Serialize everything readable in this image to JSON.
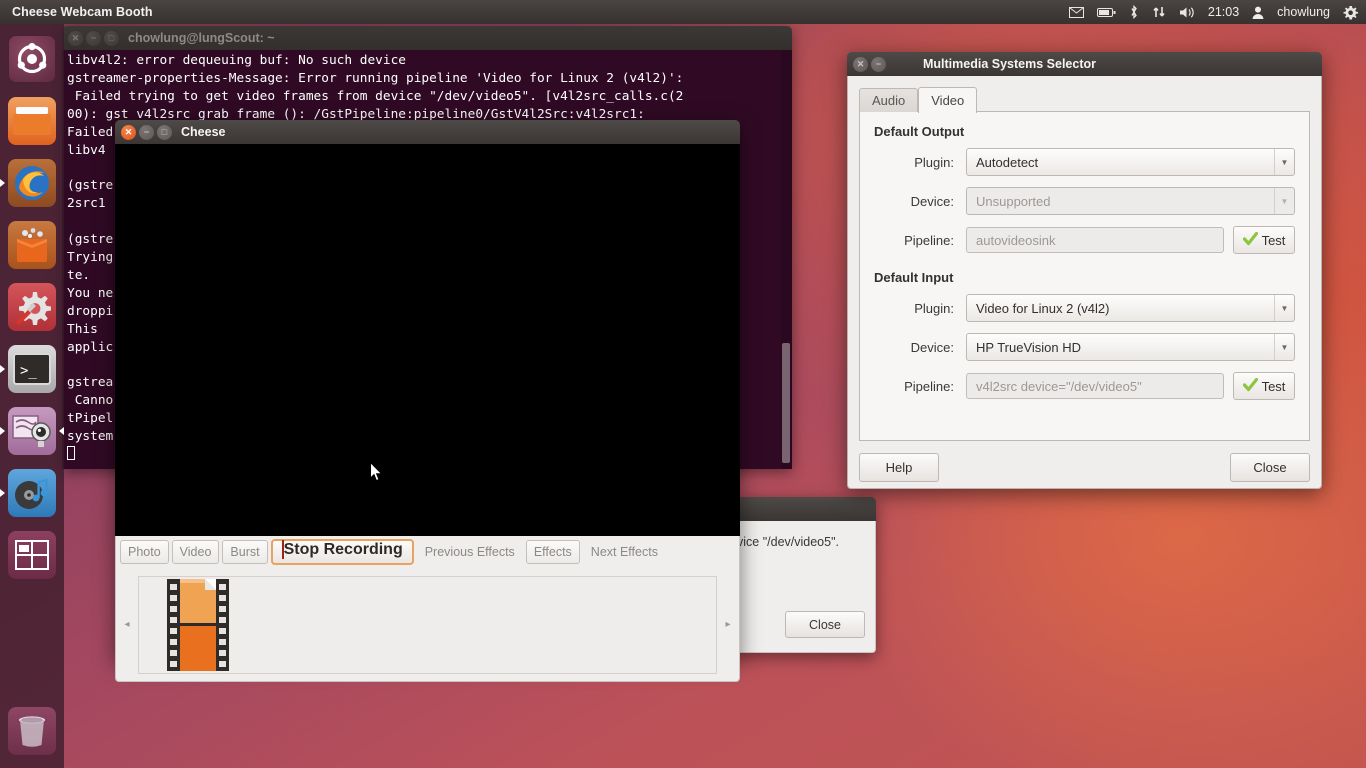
{
  "panel": {
    "title": "Cheese Webcam Booth",
    "clock": "21:03",
    "user": "chowlung",
    "icons": [
      "mail-icon",
      "battery-icon",
      "bluetooth-icon",
      "network-icon",
      "volume-icon",
      "session-gear-icon"
    ]
  },
  "launcher": {
    "items": [
      {
        "name": "ubuntu-dash",
        "label": "Dash home"
      },
      {
        "name": "files",
        "label": "Files"
      },
      {
        "name": "firefox",
        "label": "Firefox Web Browser"
      },
      {
        "name": "software-center",
        "label": "Ubuntu Software Center"
      },
      {
        "name": "system-settings",
        "label": "System Settings"
      },
      {
        "name": "terminal",
        "label": "Terminal"
      },
      {
        "name": "cheese",
        "label": "Cheese"
      },
      {
        "name": "rhythmbox",
        "label": "Rhythmbox"
      },
      {
        "name": "workspace-switcher",
        "label": "Workspace Switcher"
      },
      {
        "name": "trash",
        "label": "Trash"
      }
    ]
  },
  "terminal": {
    "title": "chowlung@lungScout: ~",
    "lines": [
      "libv4l2: error dequeuing buf: No such device",
      "gstreamer-properties-Message: Error running pipeline 'Video for Linux 2 (v4l2)':",
      " Failed trying to get video frames from device \"/dev/video5\". [v4l2src_calls.c(2",
      "00): gst_v4l2src_grab_frame (): /GstPipeline:pipeline0/GstV4l2Src:v4l2src1:",
      "Failed",
      "libv4",
      "",
      "(gstre                                                                 d v4l",
      "2src1",
      "",
      "(gstre",
      "Trying                                                                 L sta",
      "te.",
      "You ne",
      "droppi",
      "This ",
      "applic",
      "",
      "gstrea                                                              l2)':",
      " Canno                                                              : /Gs",
      "tPipel",
      "system"
    ]
  },
  "cheese": {
    "title": "Cheese",
    "buttons": {
      "photo": "Photo",
      "video": "Video",
      "burst": "Burst",
      "stop_recording": "Stop Recording",
      "previous_effects": "Previous Effects",
      "effects": "Effects",
      "next_effects": "Next Effects"
    },
    "thumbnail": {
      "name": "video-file-thumbnail"
    },
    "nav": {
      "prev": "◂",
      "next": "▸"
    }
  },
  "error_dialog": {
    "text": "vice \"/dev/video5\".",
    "close_label": "Close"
  },
  "mss": {
    "title": "Multimedia Systems Selector",
    "tabs": [
      {
        "label": "Audio",
        "active": false
      },
      {
        "label": "Video",
        "active": true
      }
    ],
    "default_output": {
      "heading": "Default Output",
      "plugin_label": "Plugin:",
      "plugin_value": "Autodetect",
      "device_label": "Device:",
      "device_value": "Unsupported",
      "pipeline_label": "Pipeline:",
      "pipeline_value": "autovideosink",
      "test_label": "Test"
    },
    "default_input": {
      "heading": "Default Input",
      "plugin_label": "Plugin:",
      "plugin_value": "Video for Linux 2 (v4l2)",
      "device_label": "Device:",
      "device_value": "HP TrueVision HD",
      "pipeline_label": "Pipeline:",
      "pipeline_value": "v4l2src device=\"/dev/video5\"",
      "test_label": "Test"
    },
    "help_label": "Help",
    "close_label": "Close"
  },
  "colors": {
    "ubuntu_orange": "#dd4814",
    "terminal_bg": "#300a24",
    "focus_border": "#e8a262",
    "record_red": "#c32b1c"
  }
}
